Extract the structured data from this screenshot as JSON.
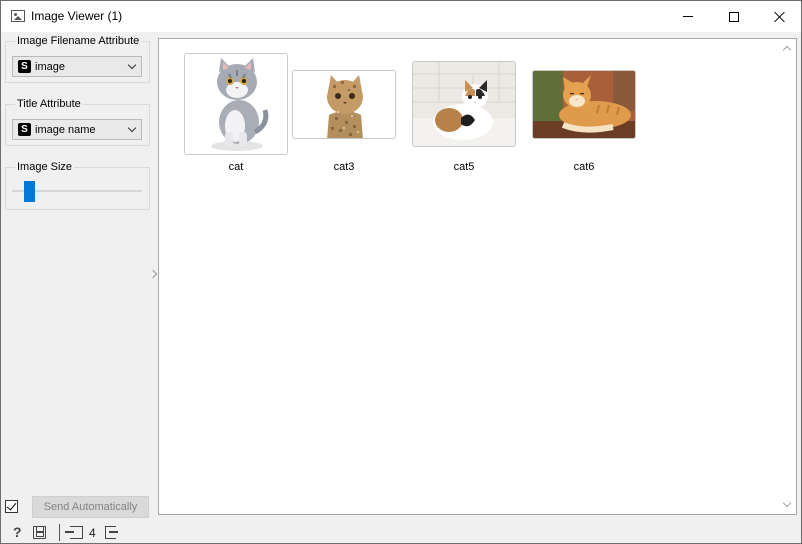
{
  "window": {
    "title": "Image Viewer (1)",
    "icon": "image-icon",
    "controls": [
      "minimize-icon",
      "maximize-icon",
      "close-icon"
    ]
  },
  "sidebar": {
    "filename_group": {
      "label": "Image Filename Attribute",
      "type_badge": "S",
      "selected": "image"
    },
    "title_group": {
      "label": "Title Attribute",
      "type_badge": "S",
      "selected": "image name"
    },
    "size_group": {
      "label": "Image Size",
      "slider_fraction": 0.1
    }
  },
  "images": [
    {
      "caption": "cat",
      "picture": "cartoon-kitten"
    },
    {
      "caption": "cat3",
      "picture": "mosaic-cat"
    },
    {
      "caption": "cat5",
      "picture": "calico-kitten"
    },
    {
      "caption": "cat6",
      "picture": "ginger-cat-lying"
    }
  ],
  "footer": {
    "auto_send_checked": true,
    "send_label": "Send Automatically"
  },
  "statusbar": {
    "help_glyph": "?",
    "input_count": "4"
  },
  "colors": {
    "accent": "#0078d7",
    "panel_bg": "#f0f0f0",
    "view_bg": "#ffffff"
  }
}
